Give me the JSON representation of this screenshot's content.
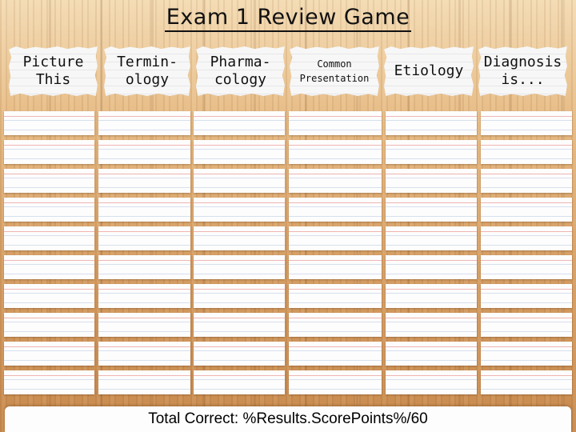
{
  "title": "Exam 1 Review Game",
  "categories": [
    {
      "label": "Picture\nThis"
    },
    {
      "label": "Termin-\nology"
    },
    {
      "label": "Pharma-\ncology"
    },
    {
      "label": "Common\nPresentation"
    },
    {
      "label": "Etiology"
    },
    {
      "label": "Diagnosis\nis..."
    }
  ],
  "board": {
    "rows": 10,
    "columns": 6
  },
  "footer": {
    "score_text": "Total Correct: %Results.ScorePoints%/60"
  }
}
